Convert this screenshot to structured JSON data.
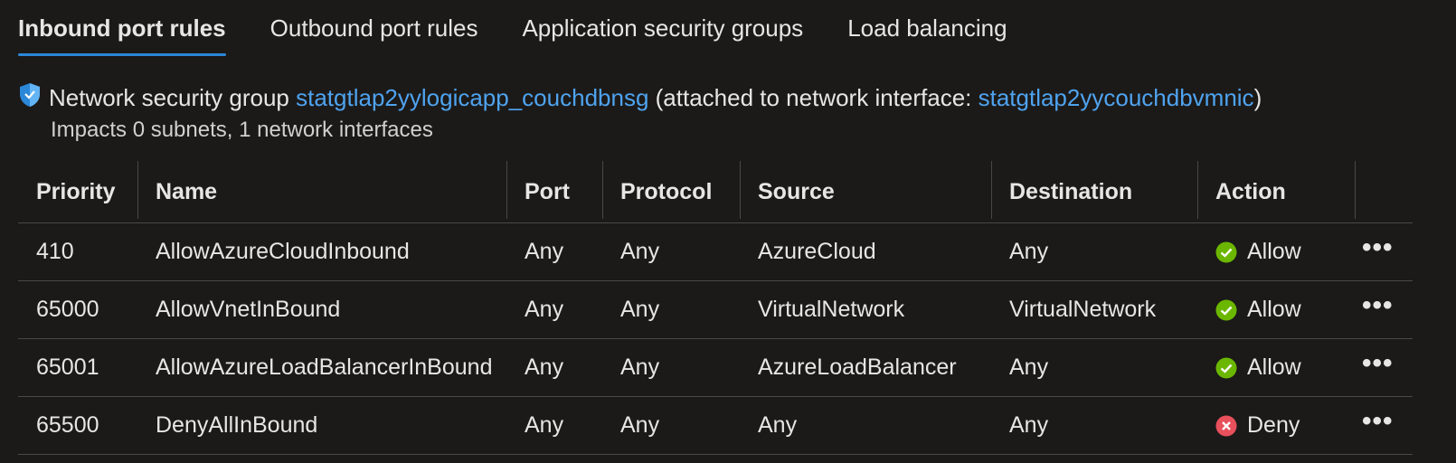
{
  "tabs": [
    {
      "label": "Inbound port rules",
      "active": true
    },
    {
      "label": "Outbound port rules",
      "active": false
    },
    {
      "label": "Application security groups",
      "active": false
    },
    {
      "label": "Load balancing",
      "active": false
    }
  ],
  "info": {
    "icon": "shield-icon",
    "prefix": "Network security group",
    "nsg_link": "statgtlap2yylogicapp_couchdbnsg",
    "attached_prefix": "(attached to network interface: ",
    "nic_link": "statgtlap2yycouchdbvmnic",
    "attached_suffix": ")",
    "impacts": "Impacts 0 subnets, 1 network interfaces"
  },
  "table": {
    "headers": [
      "Priority",
      "Name",
      "Port",
      "Protocol",
      "Source",
      "Destination",
      "Action"
    ],
    "rows": [
      {
        "priority": "410",
        "name": "AllowAzureCloudInbound",
        "port": "Any",
        "protocol": "Any",
        "source": "AzureCloud",
        "destination": "Any",
        "action": "Allow",
        "action_icon": "check-circle-icon"
      },
      {
        "priority": "65000",
        "name": "AllowVnetInBound",
        "port": "Any",
        "protocol": "Any",
        "source": "VirtualNetwork",
        "destination": "VirtualNetwork",
        "action": "Allow",
        "action_icon": "check-circle-icon"
      },
      {
        "priority": "65001",
        "name": "AllowAzureLoadBalancerInBound",
        "port": "Any",
        "protocol": "Any",
        "source": "AzureLoadBalancer",
        "destination": "Any",
        "action": "Allow",
        "action_icon": "check-circle-icon"
      },
      {
        "priority": "65500",
        "name": "DenyAllInBound",
        "port": "Any",
        "protocol": "Any",
        "source": "Any",
        "destination": "Any",
        "action": "Deny",
        "action_icon": "x-circle-icon"
      }
    ],
    "more_label": "•••"
  },
  "colors": {
    "background": "#1b1a19",
    "accent": "#2b88d8",
    "link": "#4fa3ef",
    "allow": "#6bb700",
    "deny": "#f1707b"
  }
}
